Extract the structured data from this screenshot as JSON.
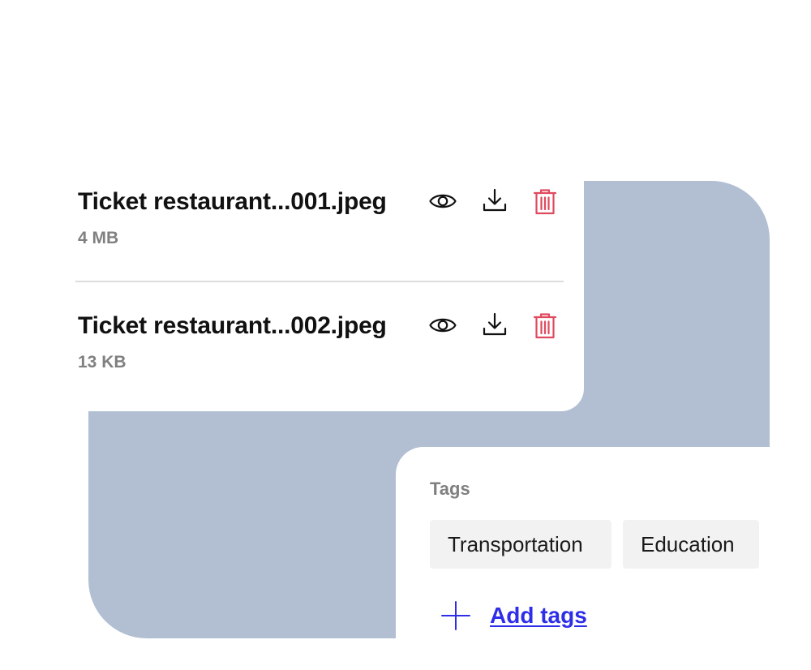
{
  "files": [
    {
      "name": "Ticket restaurant...001.jpeg",
      "size": "4 MB"
    },
    {
      "name": "Ticket restaurant...002.jpeg",
      "size": "13 KB"
    }
  ],
  "file_actions": {
    "view_icon": "eye-icon",
    "download_icon": "download-icon",
    "delete_icon": "trash-icon"
  },
  "tags": {
    "title": "Tags",
    "items": [
      "Transportation",
      "Education"
    ],
    "add_label": "Add tags",
    "add_icon": "plus-icon"
  },
  "colors": {
    "background_shape": "#b2bfd3",
    "delete": "#e04a5f",
    "link": "#2e2ee8",
    "muted_text": "#808080",
    "chip_background": "#f2f2f2"
  }
}
